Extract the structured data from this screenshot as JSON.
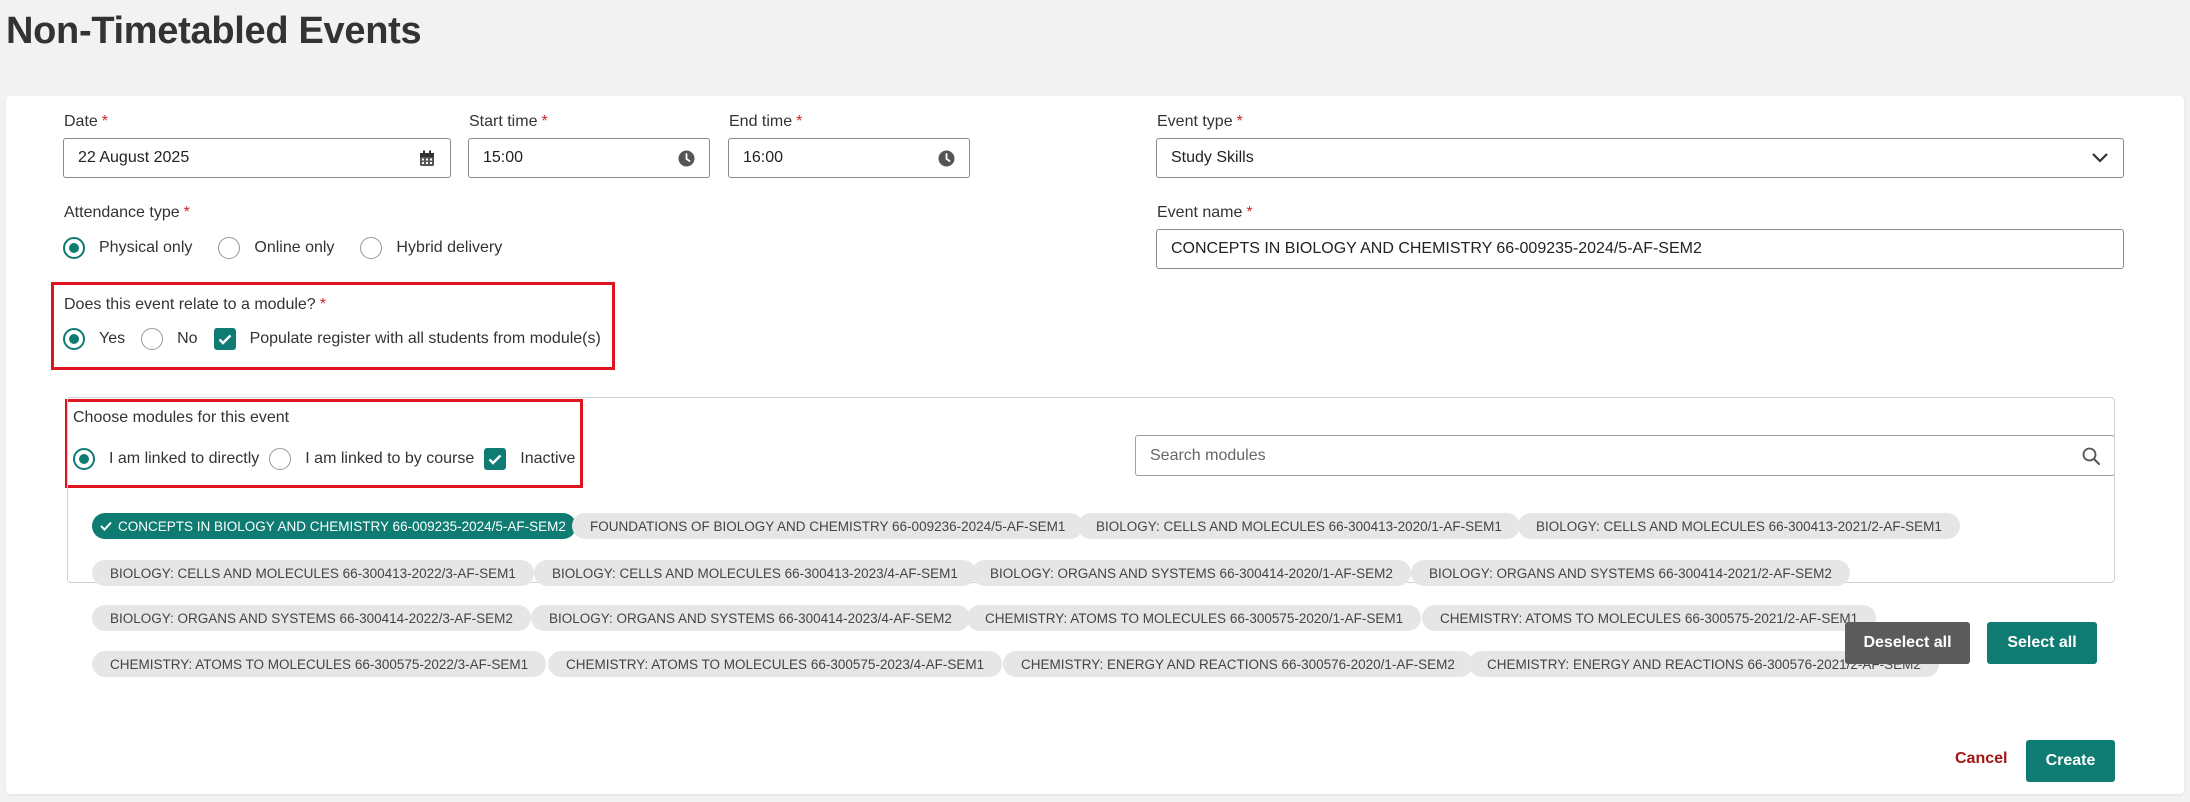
{
  "page": {
    "title": "Non-Timetabled Events"
  },
  "required_mark": "*",
  "form": {
    "date": {
      "label": "Date",
      "value": "22 August 2025",
      "icon": "calendar-icon"
    },
    "start_time": {
      "label": "Start time",
      "value": "15:00",
      "icon": "clock-icon"
    },
    "end_time": {
      "label": "End time",
      "value": "16:00",
      "icon": "clock-icon"
    },
    "event_type": {
      "label": "Event type",
      "value": "Study Skills",
      "icon": "chevron-down-icon"
    },
    "attendance": {
      "label": "Attendance type",
      "options": [
        "Physical only",
        "Online only",
        "Hybrid delivery"
      ],
      "selected": "Physical only"
    },
    "event_name": {
      "label": "Event name",
      "value": "CONCEPTS IN BIOLOGY AND CHEMISTRY 66-009235-2024/5-AF-SEM2"
    },
    "relate_module": {
      "label": "Does this event relate to a module?",
      "options": [
        "Yes",
        "No"
      ],
      "selected": "Yes",
      "populate_label": "Populate register with all students from module(s)",
      "populate_checked": true
    },
    "choose_modules": {
      "label": "Choose modules for this event",
      "options": [
        "I am linked to directly",
        "I am linked to by course"
      ],
      "selected": "I am linked to directly",
      "inactive_label": "Inactive",
      "inactive_checked": true
    },
    "search": {
      "placeholder": "Search modules",
      "icon": "search-icon"
    },
    "modules": [
      {
        "label": "CONCEPTS IN BIOLOGY AND CHEMISTRY 66-009235-2024/5-AF-SEM2",
        "selected": true
      },
      {
        "label": "FOUNDATIONS OF BIOLOGY AND CHEMISTRY 66-009236-2024/5-AF-SEM1",
        "selected": false
      },
      {
        "label": "BIOLOGY: CELLS AND MOLECULES 66-300413-2020/1-AF-SEM1",
        "selected": false
      },
      {
        "label": "BIOLOGY: CELLS AND MOLECULES 66-300413-2021/2-AF-SEM1",
        "selected": false
      },
      {
        "label": "BIOLOGY: CELLS AND MOLECULES 66-300413-2022/3-AF-SEM1",
        "selected": false
      },
      {
        "label": "BIOLOGY: CELLS AND MOLECULES 66-300413-2023/4-AF-SEM1",
        "selected": false
      },
      {
        "label": "BIOLOGY: ORGANS AND SYSTEMS 66-300414-2020/1-AF-SEM2",
        "selected": false
      },
      {
        "label": "BIOLOGY: ORGANS AND SYSTEMS 66-300414-2021/2-AF-SEM2",
        "selected": false
      },
      {
        "label": "BIOLOGY: ORGANS AND SYSTEMS 66-300414-2022/3-AF-SEM2",
        "selected": false
      },
      {
        "label": "BIOLOGY: ORGANS AND SYSTEMS 66-300414-2023/4-AF-SEM2",
        "selected": false
      },
      {
        "label": "CHEMISTRY: ATOMS TO MOLECULES 66-300575-2020/1-AF-SEM1",
        "selected": false
      },
      {
        "label": "CHEMISTRY: ATOMS TO MOLECULES 66-300575-2021/2-AF-SEM1",
        "selected": false
      },
      {
        "label": "CHEMISTRY: ATOMS TO MOLECULES 66-300575-2022/3-AF-SEM1",
        "selected": false
      },
      {
        "label": "CHEMISTRY: ATOMS TO MOLECULES 66-300575-2023/4-AF-SEM1",
        "selected": false
      },
      {
        "label": "CHEMISTRY: ENERGY AND REACTIONS 66-300576-2020/1-AF-SEM2",
        "selected": false
      },
      {
        "label": "CHEMISTRY: ENERGY AND REACTIONS 66-300576-2021/2-AF-SEM2",
        "selected": false
      }
    ],
    "deselect_all_label": "Deselect all",
    "select_all_label": "Select all",
    "cancel_label": "Cancel",
    "create_label": "Create"
  },
  "colors": {
    "accent": "#0e7c72",
    "highlight_box": "#e0141e",
    "cancel": "#a31515",
    "grey_button": "#5b5b5b"
  }
}
